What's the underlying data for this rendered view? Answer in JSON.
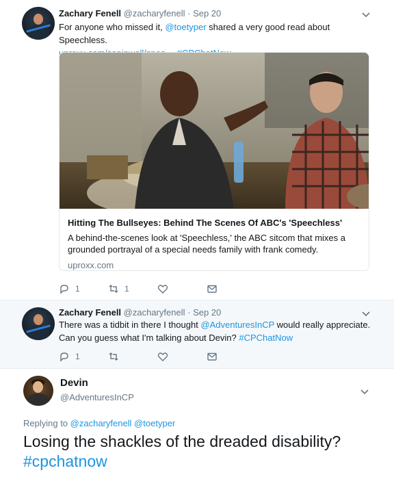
{
  "tweets": [
    {
      "name": "Zachary Fenell",
      "handle": "@zacharyfenell",
      "separator": "·",
      "time": "Sep 20",
      "text": {
        "part1": "For anyone who missed it, ",
        "mention": "@toetyper",
        "part2": " shared a very good read about Speechless.",
        "link": "uproxx.com/sepinwall/spee…",
        "space": " ",
        "hashtag": "#CPChatNow"
      },
      "card": {
        "title": "Hitting The Bullseyes: Behind The Scenes Of ABC's 'Speechless'",
        "description": "A behind-the-scenes look at 'Speechless,' the ABC sitcom that mixes a grounded portrayal of a special needs family with frank comedy.",
        "domain": "uproxx.com"
      },
      "actions": {
        "reply_count": "1",
        "retweet_count": "1"
      }
    },
    {
      "name": "Zachary Fenell",
      "handle": "@zacharyfenell",
      "separator": "·",
      "time": "Sep 20",
      "text": {
        "part1": "There was a tidbit in there I thought ",
        "mention": "@AdventuresInCP",
        "part2": " would really appreciate.",
        "part3": "Can you guess what I'm talking about Devin? ",
        "hashtag": "#CPChatNow"
      },
      "actions": {
        "reply_count": "1"
      }
    },
    {
      "name": "Devin",
      "handle": "@AdventuresInCP",
      "replying": {
        "prefix": "Replying to ",
        "mention1": "@zacharyfenell",
        "space": " ",
        "mention2": "@toetyper"
      },
      "text": {
        "part1": "Losing the shackles of the dreaded disability? ",
        "hashtag": "#cpchatnow"
      }
    }
  ],
  "colors": {
    "link": "#1b95e0",
    "muted": "#657786",
    "thread_line": "#c4d7e6",
    "highlight_bg": "#f5f8fa"
  },
  "icons": [
    "chevron-down-icon",
    "reply-icon",
    "retweet-icon",
    "like-icon",
    "message-icon"
  ]
}
